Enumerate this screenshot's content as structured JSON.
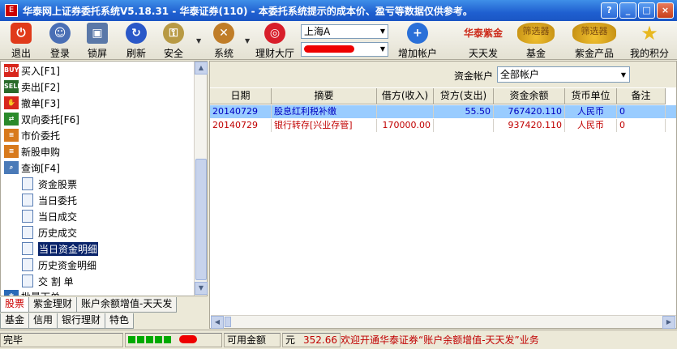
{
  "window": {
    "title": "华泰网上证券委托系统V5.18.31 - 华泰证券(110) - 本委托系统提示的成本价、盈亏等数据仅供参考。",
    "icon_text": "E"
  },
  "toolbar": {
    "buttons": [
      {
        "label": "退出",
        "icon": "power-icon",
        "color": "#e03a1a"
      },
      {
        "label": "登录",
        "icon": "user-icon",
        "color": "#4a6fb5"
      },
      {
        "label": "锁屏",
        "icon": "lock-icon",
        "color": "#5a78a8"
      },
      {
        "label": "刷新",
        "icon": "refresh-icon",
        "color": "#2a58c8"
      },
      {
        "label": "安全",
        "icon": "key-icon",
        "color": "#b89a44"
      },
      {
        "label": "系统",
        "icon": "tools-icon",
        "color": "#c07d28"
      },
      {
        "label": "理财大厅",
        "icon": "target-icon",
        "color": "#d81e2a"
      },
      {
        "label": "增加帐户",
        "icon": "add-user-icon",
        "color": "#2a70d8"
      },
      {
        "label": "天天发",
        "icon": "tiantianfa-icon",
        "color": "#cc2a1a"
      },
      {
        "label": "基金",
        "icon": "fund-screener-icon",
        "color": "#d4a020"
      },
      {
        "label": "紫金产品",
        "icon": "zijin-screener-icon",
        "color": "#d4a020"
      },
      {
        "label": "我的积分",
        "icon": "star-icon",
        "color": "#e8b820"
      }
    ],
    "market_select": "上海A",
    "account_select_masked": true,
    "promo_badges": {
      "tiantianfa": "华泰紫金",
      "fund": "筛选器",
      "zijin": "筛选器"
    }
  },
  "sidebar": {
    "items": [
      {
        "label": "买入[F1]",
        "icon": "buy-icon",
        "color": "#d8261c"
      },
      {
        "label": "卖出[F2]",
        "icon": "sell-icon",
        "color": "#2a6a2a"
      },
      {
        "label": "撤单[F3]",
        "icon": "cancel-order-icon",
        "color": "#d8261c"
      },
      {
        "label": "双向委托[F6]",
        "icon": "two-way-order-icon",
        "color": "#2a8a2a"
      },
      {
        "label": "市价委托",
        "icon": "market-order-icon",
        "color": "#d87a1c"
      },
      {
        "label": "新股申购",
        "icon": "ipo-subscribe-icon",
        "color": "#d87a1c"
      },
      {
        "label": "查询[F4]",
        "icon": "query-icon",
        "color": "#4a7ab8"
      }
    ],
    "subitems": [
      {
        "label": "资金股票"
      },
      {
        "label": "当日委托"
      },
      {
        "label": "当日成交"
      },
      {
        "label": "历史成交"
      },
      {
        "label": "当日资金明细",
        "selected": true
      },
      {
        "label": "历史资金明细"
      },
      {
        "label": "交 割 单"
      }
    ],
    "cutoff_item": "批量下单",
    "tabs_row1": [
      {
        "label": "股票",
        "active": true
      },
      {
        "label": "紫金理财"
      },
      {
        "label": "账户余额增值-天天发"
      }
    ],
    "tabs_row2": [
      {
        "label": "基金"
      },
      {
        "label": "信用"
      },
      {
        "label": "银行理财"
      },
      {
        "label": "特色"
      }
    ]
  },
  "main": {
    "account_label": "资金帐户",
    "account_value": "全部帐户",
    "columns": [
      "日期",
      "摘要",
      "借方(收入)",
      "贷方(支出)",
      "资金余额",
      "货币单位",
      "备注"
    ],
    "rows": [
      {
        "date": "20140729",
        "summary": "股息红利税补缴",
        "debit": "",
        "credit": "55.50",
        "balance": "767420.110",
        "currency": "人民币",
        "note": "0",
        "selected": true
      },
      {
        "date": "20140729",
        "summary": "银行转存[兴业存管]",
        "debit": "170000.00",
        "credit": "",
        "balance": "937420.110",
        "currency": "人民币",
        "note": "0",
        "selected": false
      }
    ]
  },
  "statusbar": {
    "status": "完毕",
    "available_label": "可用金额",
    "available_value": "352.66",
    "unit": "元",
    "marquee": "欢迎开通华泰证券“账户余额增值-天天发”业务",
    "connection_boxes": 5
  },
  "colors": {
    "selected_row_bg": "#99ccff",
    "row_text_red": "#c00000",
    "row_text_blue": "#0000c0",
    "title_blue": "#1f5fd0"
  }
}
